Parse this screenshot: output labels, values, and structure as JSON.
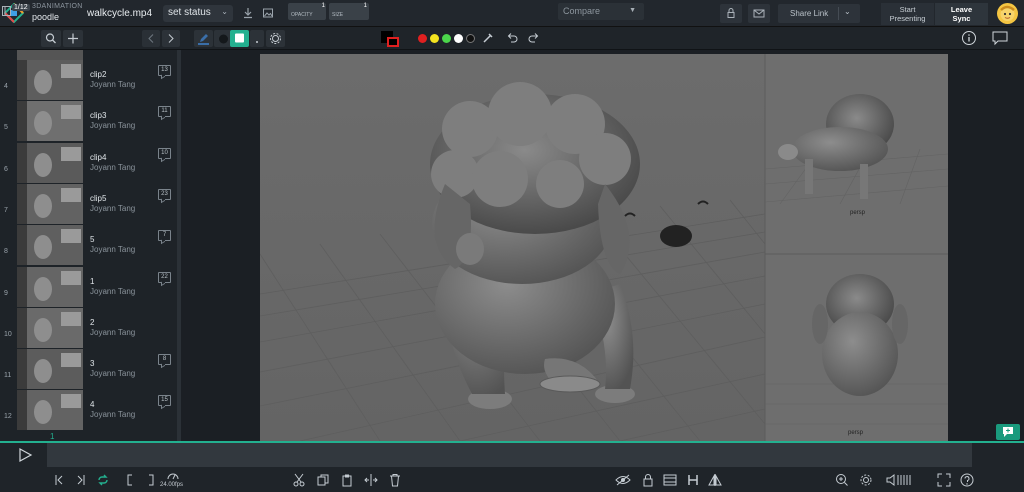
{
  "header": {
    "org": "3DANIMATION",
    "project": "poodle",
    "filename": "walkcycle.mp4",
    "status_label": "set status",
    "share_label": "Share Link",
    "present_label_1": "Start",
    "present_label_2": "Presenting",
    "leave_label_1": "Leave",
    "leave_label_2": "Sync"
  },
  "toolbar": {
    "page_badge": "1/12",
    "opacity_label": "OPACITY",
    "opacity_value": "1",
    "size_label": "SIZE",
    "size_value": "1",
    "colors": [
      "#e02020",
      "#f4e31f",
      "#4bd64b",
      "#ffffff",
      "#111111"
    ],
    "compare_label": "Compare"
  },
  "clips": [
    {
      "index": "4",
      "name": "clip2",
      "author": "Joyann Tang",
      "comments": "13"
    },
    {
      "index": "5",
      "name": "clip3",
      "author": "Joyann Tang",
      "comments": "11"
    },
    {
      "index": "6",
      "name": "clip4",
      "author": "Joyann Tang",
      "comments": "10"
    },
    {
      "index": "7",
      "name": "clip5",
      "author": "Joyann Tang",
      "comments": "23"
    },
    {
      "index": "8",
      "name": "5",
      "author": "Joyann Tang",
      "comments": "7"
    },
    {
      "index": "9",
      "name": "1",
      "author": "Joyann Tang",
      "comments": "22"
    },
    {
      "index": "10",
      "name": "2",
      "author": "Joyann Tang",
      "comments": ""
    },
    {
      "index": "11",
      "name": "3",
      "author": "Joyann Tang",
      "comments": "8"
    },
    {
      "index": "12",
      "name": "4",
      "author": "Joyann Tang",
      "comments": "15"
    }
  ],
  "viewport": {
    "camera_label_1": "persp",
    "camera_label_2": "persp"
  },
  "timeline": {
    "frame": "1",
    "fps": "24.00fps"
  }
}
